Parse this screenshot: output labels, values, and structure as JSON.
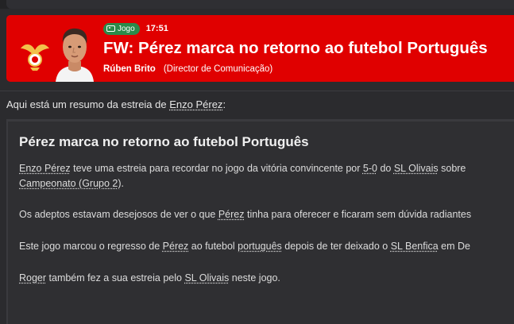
{
  "header": {
    "badge_label": "Jogo",
    "time": "17:51",
    "title": "FW: Pérez marca no retorno ao futebol Português",
    "author_name": "Rúben Brito",
    "author_role": "(Director de Comunicação)"
  },
  "intro": {
    "prefix": "Aqui está um resumo da estreia de ",
    "player": "Enzo Pérez",
    "suffix": ":"
  },
  "article": {
    "title": "Pérez marca no retorno ao futebol Português",
    "p1": {
      "player": "Enzo Pérez",
      "t1": " teve uma estreia para recordar no jogo da vitória convincente por ",
      "score": "5-0",
      "t2": " do ",
      "club": "SL Olivais",
      "t3": " sobre",
      "line2_link": "Campeonato (Grupo 2)",
      "line2_end": "."
    },
    "p2": {
      "t1": "Os adeptos estavam desejosos de ver o que ",
      "player": "Pérez",
      "t2": " tinha para oferecer e ficaram sem dúvida radiantes"
    },
    "p3": {
      "t1": "Este jogo marcou o regresso de ",
      "player": "Pérez",
      "t2": " ao futebol ",
      "nationality": "português",
      "t3": " depois de ter deixado o ",
      "club": "SL Benfica",
      "t4": " em De"
    },
    "p4": {
      "player": "Roger",
      "t1": " também fez a sua estreia pelo ",
      "club": "SL Olivais",
      "t2": " neste jogo."
    }
  },
  "colors": {
    "header_bg": "#e00000",
    "badge_bg": "#2a8a4a",
    "page_bg": "#2b2b2e",
    "card_bg": "#2f2f32"
  }
}
